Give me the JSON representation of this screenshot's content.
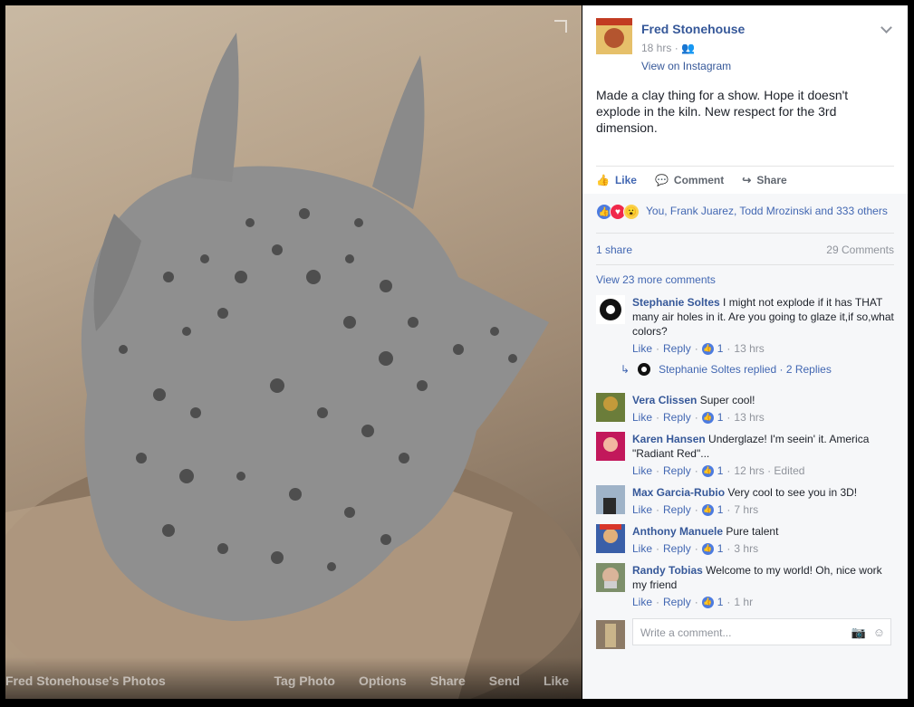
{
  "photo": {
    "title": "Fred Stonehouse's Photos",
    "actions": [
      "Tag Photo",
      "Options",
      "Share",
      "Send",
      "Like"
    ]
  },
  "post": {
    "author": "Fred Stonehouse",
    "time": "18 hrs",
    "via": "View on Instagram",
    "text": "Made a clay thing for a show. Hope it doesn't explode in the kiln. New respect for the 3rd dimension.",
    "actions": {
      "like": "Like",
      "comment": "Comment",
      "share": "Share"
    },
    "reactions_text": "You, Frank Juarez, Todd Mrozinski and 333 others",
    "shares": "1 share",
    "comments_count": "29 Comments",
    "view_more": "View 23 more comments"
  },
  "comments": [
    {
      "name": "Stephanie Soltes",
      "text": "I might not explode if it has THAT many air holes in it. Are you going to glaze it,if so,what colors?",
      "likes": "1",
      "time": "13 hrs",
      "replies_text": "Stephanie Soltes replied · 2 Replies"
    },
    {
      "name": "Vera Clissen",
      "text": "Super cool!",
      "likes": "1",
      "time": "13 hrs"
    },
    {
      "name": "Karen Hansen",
      "text": "Underglaze! I'm seein' it. America \"Radiant Red\"...",
      "likes": "1",
      "time": "12 hrs · Edited"
    },
    {
      "name": "Max Garcia-Rubio",
      "text": "Very cool to see you in 3D!",
      "likes": "1",
      "time": "7 hrs"
    },
    {
      "name": "Anthony Manuele",
      "text": "Pure talent",
      "likes": "1",
      "time": "3 hrs"
    },
    {
      "name": "Randy Tobias",
      "text": "Welcome to my world! Oh, nice work my friend",
      "likes": "1",
      "time": "1 hr"
    }
  ],
  "labels": {
    "like": "Like",
    "reply": "Reply"
  },
  "write": {
    "placeholder": "Write a comment..."
  },
  "colors": {
    "link": "#365899",
    "accent": "#4267b2",
    "muted": "#90949c"
  }
}
